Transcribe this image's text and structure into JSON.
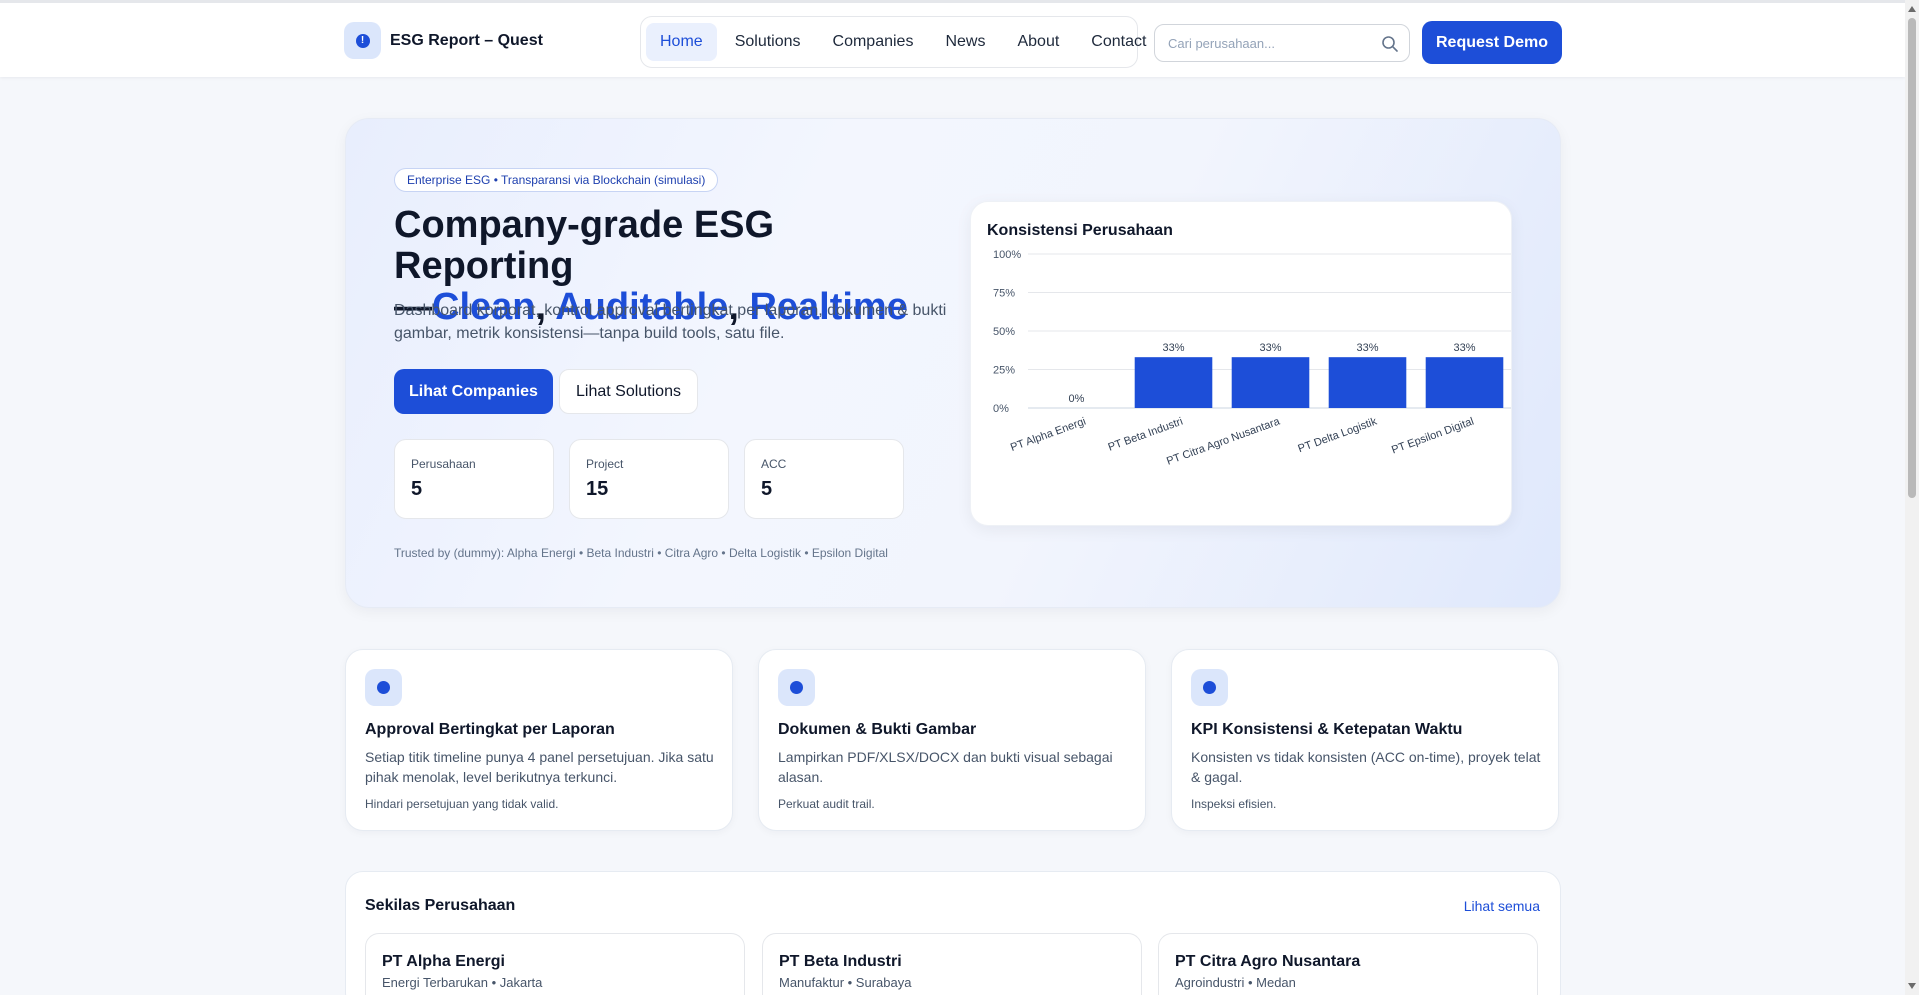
{
  "header": {
    "brand": "ESG Report – Quest",
    "nav": [
      {
        "label": "Home",
        "active": true
      },
      {
        "label": "Solutions"
      },
      {
        "label": "Companies"
      },
      {
        "label": "News"
      },
      {
        "label": "About"
      },
      {
        "label": "Contact"
      }
    ],
    "search_placeholder": "Cari perusahaan...",
    "cta_label": "Request Demo"
  },
  "hero": {
    "badge": "Enterprise ESG • Transparansi via Blockchain (simulasi)",
    "title_main": "Company-grade ESG Reporting",
    "title_dash": "—",
    "title_w1": "Clean",
    "title_sep1": ", ",
    "title_w2": "Auditable",
    "title_sep2": ", ",
    "title_w3": "Realtime",
    "description": "Dashboard korporat, kontrol approval bertingkat per laporan, dokumen & bukti gambar, metrik konsistensi—tanpa build tools, satu file.",
    "primary_button": "Lihat Companies",
    "secondary_button": "Lihat Solutions",
    "stats": [
      {
        "label": "Perusahaan",
        "value": "5"
      },
      {
        "label": "Project",
        "value": "15"
      },
      {
        "label": "ACC",
        "value": "5"
      }
    ],
    "trusted": "Trusted by (dummy): Alpha Energi • Beta Industri • Citra Agro • Delta Logistik • Epsilon Digital"
  },
  "chart_data": {
    "type": "bar",
    "title": "Konsistensi Perusahaan",
    "categories": [
      "PT Alpha Energi",
      "PT Beta Industri",
      "PT Citra Agro Nusantara",
      "PT Delta Logistik",
      "PT Epsilon Digital"
    ],
    "values": [
      0,
      33,
      33,
      33,
      33
    ],
    "data_labels": [
      "0%",
      "33%",
      "33%",
      "33%",
      "33%"
    ],
    "yticks": [
      "0%",
      "25%",
      "50%",
      "75%",
      "100%"
    ],
    "ylim": [
      0,
      100
    ],
    "grid": true,
    "bar_color": "#1d4ed8"
  },
  "features": [
    {
      "title": "Approval Bertingkat per Laporan",
      "description": "Setiap titik timeline punya 4 panel persetujuan. Jika satu pihak menolak, level berikutnya terkunci.",
      "note": "Hindari persetujuan yang tidak valid."
    },
    {
      "title": "Dokumen & Bukti Gambar",
      "description": "Lampirkan PDF/XLSX/DOCX dan bukti visual sebagai alasan.",
      "note": "Perkuat audit trail."
    },
    {
      "title": "KPI Konsistensi & Ketepatan Waktu",
      "description": "Konsisten vs tidak konsisten (ACC on-time), proyek telat & gagal.",
      "note": "Inspeksi efisien."
    }
  ],
  "overview": {
    "title": "Sekilas Perusahaan",
    "link": "Lihat semua",
    "companies": [
      {
        "name": "PT Alpha Energi",
        "meta": "Energi Terbarukan • Jakarta"
      },
      {
        "name": "PT Beta Industri",
        "meta": "Manufaktur • Surabaya"
      },
      {
        "name": "PT Citra Agro Nusantara",
        "meta": "Agroindustri • Medan"
      }
    ]
  }
}
